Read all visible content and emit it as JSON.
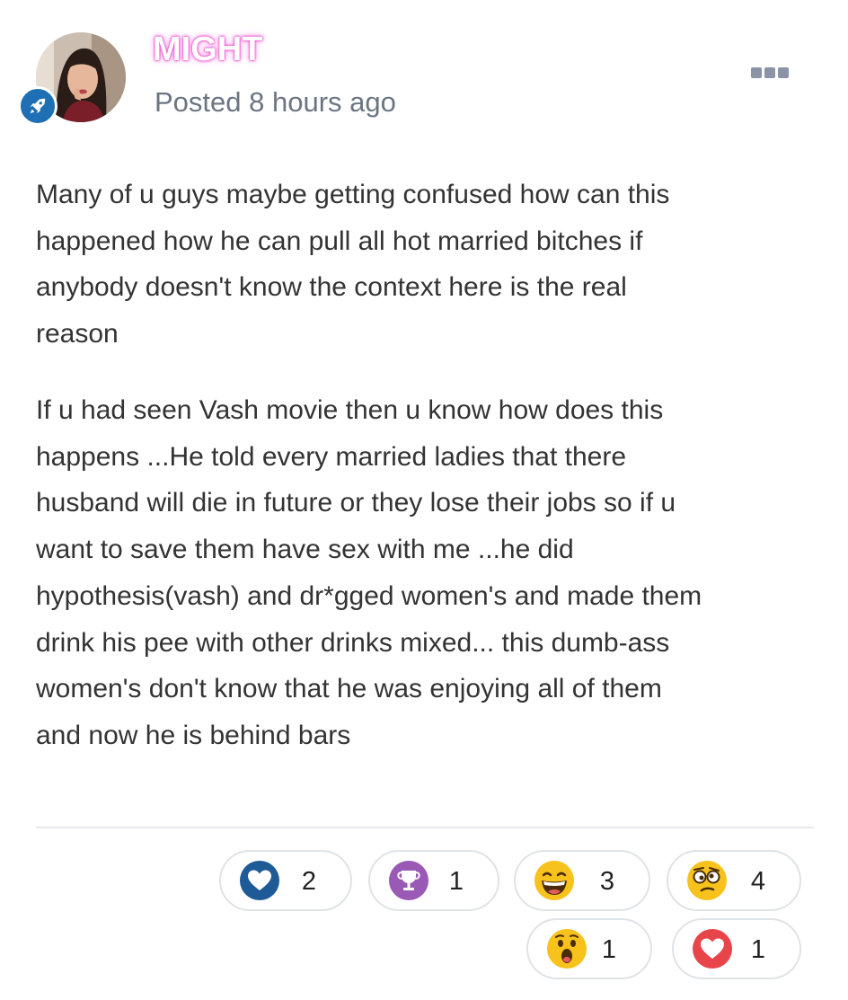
{
  "post": {
    "author": "MIGHT",
    "posted_time": "Posted 8 hours ago",
    "paragraph1": [
      "Many of u guys maybe getting confused how can this",
      "happened how he can pull all hot married bitches if",
      "anybody doesn't know the context here is the real",
      "reason"
    ],
    "paragraph2": [
      "If u had seen Vash movie then u know how does this",
      "happens ...He told every married ladies that there",
      "husband will die in future or they lose their jobs so if u",
      "want to save them have sex with me ...he did",
      "hypothesis(vash) and dr*gged women's and made them",
      "drink his pee with other drinks mixed... this dumb-ass",
      "women's don't know that he was enjoying all of them",
      "and now he is behind bars"
    ]
  },
  "reactions": [
    {
      "icon": "blue-heart-icon",
      "count": "2"
    },
    {
      "icon": "trophy-icon",
      "count": "1"
    },
    {
      "icon": "grinning-face-icon",
      "count": "3"
    },
    {
      "icon": "confused-face-icon",
      "count": "4"
    },
    {
      "icon": "surprised-face-icon",
      "count": "1"
    },
    {
      "icon": "red-heart-icon",
      "count": "1"
    }
  ],
  "colors": {
    "author_glow": "#e83fc9",
    "meta_text": "#6b7582",
    "badge_blue": "#1f6fb4"
  }
}
